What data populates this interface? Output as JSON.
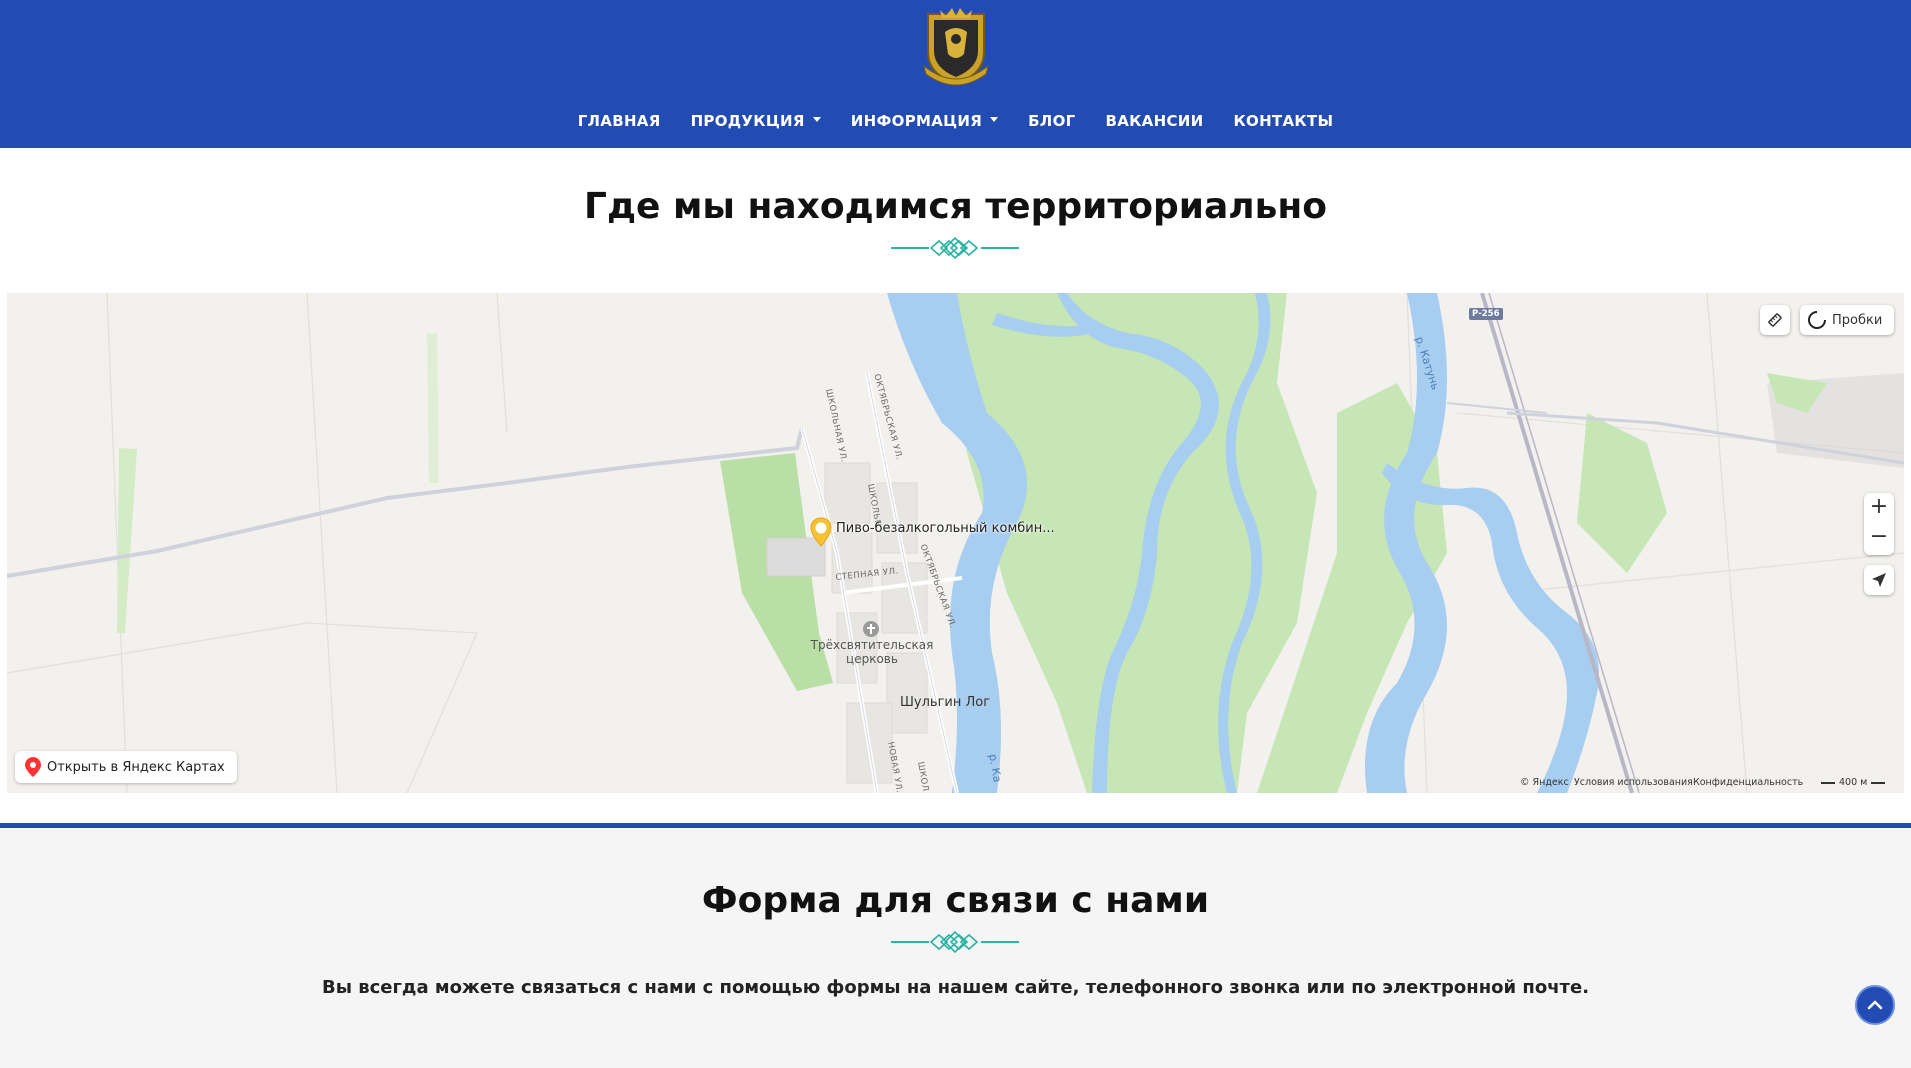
{
  "header": {
    "logo_icon": "heraldic-crest-logo",
    "nav": [
      {
        "label": "ГЛАВНАЯ",
        "dropdown": false
      },
      {
        "label": "ПРОДУКЦИЯ",
        "dropdown": true
      },
      {
        "label": "ИНФОРМАЦИЯ",
        "dropdown": true
      },
      {
        "label": "БЛОГ",
        "dropdown": false
      },
      {
        "label": "ВАКАНСИИ",
        "dropdown": false
      },
      {
        "label": "КОНТАКТЫ",
        "dropdown": false
      }
    ]
  },
  "location_section": {
    "title": "Где мы находимся территориально"
  },
  "map": {
    "traffic_button": "Пробки",
    "zoom_in": "+",
    "zoom_out": "−",
    "place_marker": "Пиво-безалкогольный комбин...",
    "open_in_yandex": "Открыть в Яндекс Картах",
    "church": "Трёхсвятительская церковь",
    "church_line1": "Трёхсвятительская",
    "church_line2": "церковь",
    "village": "Шульгин Лог",
    "river_katun": "р. Катунь",
    "river_ka": "р. Ка",
    "road_badge": "Р-256",
    "streets": {
      "shkolnaya": "ШКОЛЬНАЯ УЛ.",
      "oktyabrskaya": "ОКТЯБРЬСКАЯ УЛ.",
      "shkolnaya_short": "ШКОЛЬН",
      "oktyabrskaya2": "ОКТЯБРЬСКАЯ УЛ.",
      "stepnaya": "СТЕПНАЯ УЛ.",
      "novaya": "НОВАЯ УЛ.",
      "shkol2": "ШКОЛ"
    },
    "copyright": "© Яндекс",
    "terms": "Условия использования",
    "privacy": "Конфиденциальность",
    "scale": "400 м",
    "colors": {
      "water": "#a7cdf0",
      "green": "#c6e6b6",
      "land": "#f3f1ed"
    }
  },
  "contact_section": {
    "title": "Форма для связи с нами",
    "description": "Вы всегда можете связаться с нами с помощью формы на нашем сайте, телефонного звонка или по электронной почте."
  },
  "colors": {
    "brand_blue": "#224cb4",
    "ornament_teal": "#2bb3a3"
  }
}
